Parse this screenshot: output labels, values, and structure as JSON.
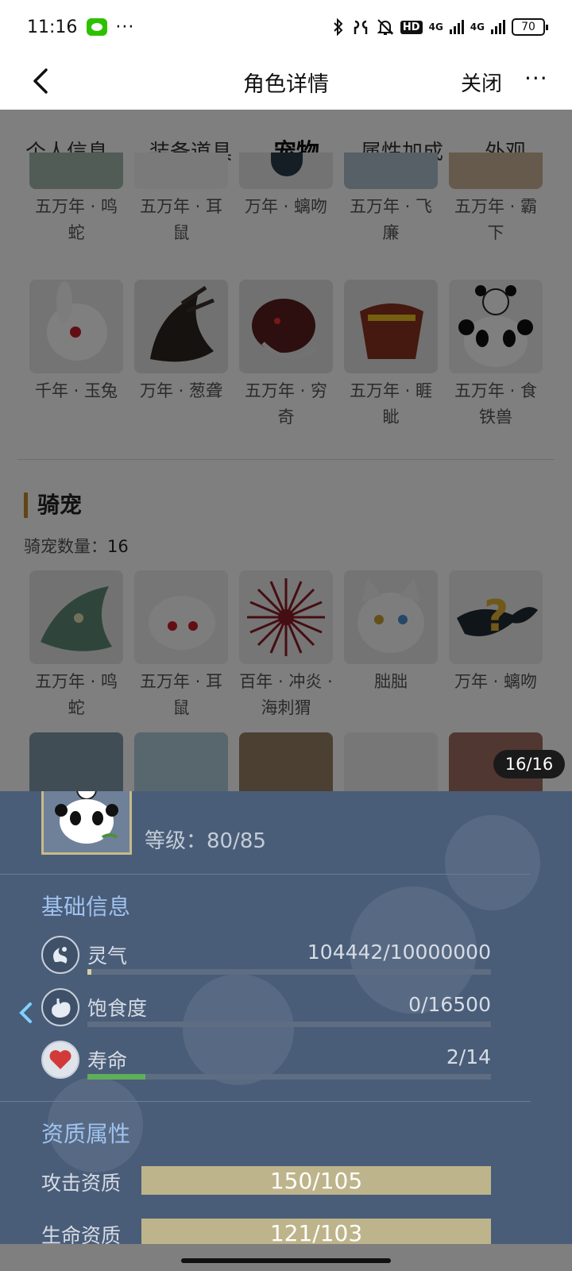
{
  "status_bar": {
    "time": "11:16",
    "more": "···",
    "network_1": "4G",
    "network_2": "4G",
    "hd": "HD",
    "battery": "70"
  },
  "header": {
    "title": "角色详情",
    "close_label": "关闭",
    "more": "···"
  },
  "tabs": [
    "个人信息",
    "装备道具",
    "宠物",
    "属性加成",
    "外观"
  ],
  "active_tab": "宠物",
  "pets_partial_row": [
    {
      "name": "五万年 · 鸣蛇",
      "color": "#7a9a86"
    },
    {
      "name": "五万年 · 耳鼠",
      "color": "#e8e8e8"
    },
    {
      "name": "万年 · 螭吻",
      "color": "#2b3a4a"
    },
    {
      "name": "五万年 · 飞廉",
      "color": "#6c93b3"
    },
    {
      "name": "五万年 · 霸下",
      "color": "#b07b3c"
    }
  ],
  "pets_row_2": [
    {
      "name": "千年 · 玉兔",
      "color": "#f1f1f1"
    },
    {
      "name": "万年 · 葱聋",
      "color": "#2a2420"
    },
    {
      "name": "五万年 · 穷奇",
      "color": "#5a1e1e"
    },
    {
      "name": "五万年 · 睚眦",
      "color": "#8a3020"
    },
    {
      "name": "五万年 · 食铁兽",
      "color": "#f3f3f3"
    }
  ],
  "mounts": {
    "title": "骑宠",
    "count_label": "骑宠数量：",
    "count_value": "16",
    "row_1": [
      {
        "name": "五万年 · 鸣蛇",
        "color": "#5f8a78"
      },
      {
        "name": "五万年 · 耳鼠",
        "color": "#f2f2f2"
      },
      {
        "name": "百年 · 冲炎 · 海刺猬",
        "color": "#8a1d25"
      },
      {
        "name": "朏朏",
        "color": "#e9e9e9"
      },
      {
        "name": "万年 · 螭吻",
        "color": "#202a35"
      }
    ],
    "row_2": [
      {
        "name": "",
        "color": "#4a6f88"
      },
      {
        "name": "",
        "color": "#8fb7cc"
      },
      {
        "name": "",
        "color": "#6a4a20"
      },
      {
        "name": "",
        "color": "#efefef"
      },
      {
        "name": "",
        "color": "#7a3020"
      }
    ]
  },
  "pager": "16/16",
  "detail": {
    "level": "等级：80/85",
    "basic_title": "基础信息",
    "stats": [
      {
        "label": "灵气",
        "value": "104442/10000000",
        "progress": 0.01,
        "color": "#d9cf9a",
        "icon": "spirit-icon"
      },
      {
        "label": "饱食度",
        "value": "0/16500",
        "progress": 0.0,
        "color": "#d9cf9a",
        "icon": "stomach-icon"
      },
      {
        "label": "寿命",
        "value": "2/14",
        "progress": 0.143,
        "color": "#5fae5a",
        "icon": "heart-icon"
      }
    ],
    "aptitude_title": "资质属性",
    "aptitudes": [
      {
        "label": "攻击资质",
        "value": "150/105"
      },
      {
        "label": "生命资质",
        "value": "121/103"
      }
    ]
  }
}
